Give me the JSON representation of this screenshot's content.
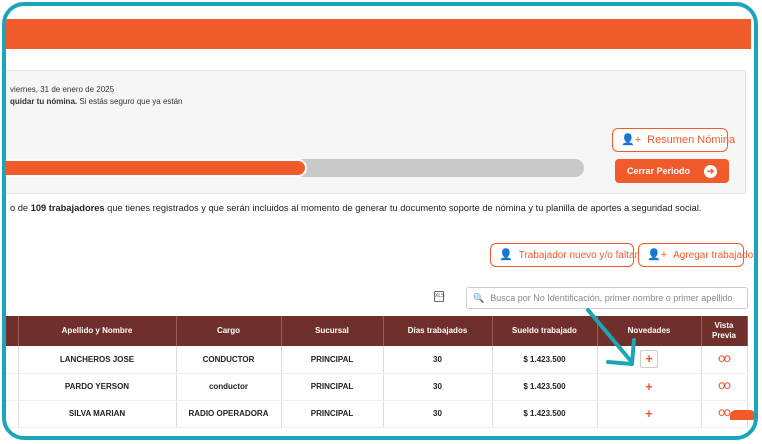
{
  "panel": {
    "date_text": "viernes, 31 de enero de 2025",
    "instruction_bold": "quidar tu nómina.",
    "instruction_rest": " Si estás seguro que ya están",
    "progress_fraction": 0.52
  },
  "buttons": {
    "resumen_nomina": "Resumen Nómina",
    "cerrar_periodo": "Cerrar Periodo",
    "trabajador_nuevo": "Trabajador nuevo y/o faltante",
    "agregar_trabajador": "Agregar trabajador"
  },
  "info": {
    "prefix": "o de ",
    "count_bold": "109 trabajadores",
    "suffix": " que tienes registrados y que serán incluidos al momento de generar tu documento soporte de nómina y tu planilla de aportes a seguridad social."
  },
  "search": {
    "placeholder": "Busca por No Identificación, primer nombre o primer apellido"
  },
  "table": {
    "headers": {
      "nombre": "Apellido y Nombre",
      "cargo": "Cargo",
      "sucursal": "Sucursal",
      "dias": "Días trabajados",
      "sueldo": "Sueldo trabajado",
      "novedades": "Novedades",
      "vista_line1": "Vista",
      "vista_line2": "Previa"
    },
    "rows": [
      {
        "nombre": "LANCHEROS JOSE",
        "cargo": "CONDUCTOR",
        "sucursal": "PRINCIPAL",
        "dias": "30",
        "sueldo": "$ 1.423.500",
        "novedad": "+"
      },
      {
        "nombre": "PARDO YERSON",
        "cargo": "conductor",
        "sucursal": "PRINCIPAL",
        "dias": "30",
        "sueldo": "$ 1.423.500",
        "novedad": "+"
      },
      {
        "nombre": "SILVA MARIAN",
        "cargo": "RADIO OPERADORA",
        "sucursal": "PRINCIPAL",
        "dias": "30",
        "sueldo": "$ 1.423.500",
        "novedad": "+"
      }
    ]
  },
  "icons": {
    "person_plus": "person-plus-icon",
    "arrow_right": "arrow-right-icon",
    "search": "search-icon",
    "excel": "excel-export-icon",
    "glasses": "glasses-icon",
    "pointer_arrow": "teal-arrow-icon"
  },
  "colors": {
    "accent": "#f15a2b",
    "header_bg": "#6f2f2a",
    "frame": "#1aa6b7"
  }
}
